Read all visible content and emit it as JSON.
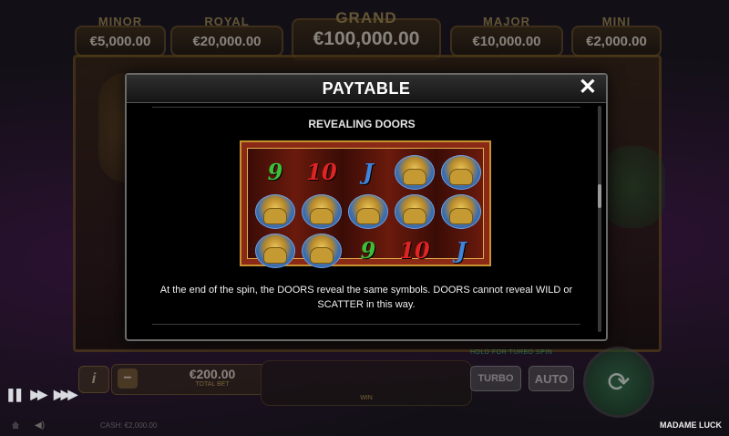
{
  "jackpots": {
    "minor": {
      "name": "MINOR",
      "value": "€5,000.00"
    },
    "royal": {
      "name": "ROYAL",
      "value": "€20,000.00"
    },
    "grand": {
      "name": "GRAND",
      "value": "€100,000.00"
    },
    "major": {
      "name": "MAJOR",
      "value": "€10,000.00"
    },
    "mini": {
      "name": "MINI",
      "value": "€2,000.00"
    }
  },
  "modal": {
    "title": "PAYTABLE",
    "close_glyph": "✕",
    "section_title": "REVEALING DOORS",
    "example_grid": [
      [
        "9",
        "10",
        "J",
        "frog",
        "frog"
      ],
      [
        "frog",
        "frog",
        "frog",
        "frog",
        "frog"
      ],
      [
        "frog",
        "frog",
        "9",
        "10",
        "J"
      ]
    ],
    "description": "At the end of the spin, the DOORS reveal the same symbols. DOORS cannot reveal WILD or SCATTER in this way."
  },
  "controls": {
    "info_label": "i",
    "bet_value": "€200.00",
    "bet_label": "TOTAL BET",
    "minus": "−",
    "plus": "+",
    "win_label": "WIN",
    "hold_label": "HOLD FOR TURBO SPIN",
    "turbo_label": "TURBO",
    "auto_label": "AUTO",
    "spin_glyph": "⟳"
  },
  "playback": {
    "pause": "❚❚",
    "play": "▶▶",
    "fast": "▶▶▶"
  },
  "footer": {
    "info_text": "CASH: €2,000.00",
    "game_name": "MADAME LUCK"
  },
  "icons": {
    "close": "close-icon",
    "home": "home-icon",
    "sound": "sound-icon",
    "spin": "spin-icon"
  }
}
